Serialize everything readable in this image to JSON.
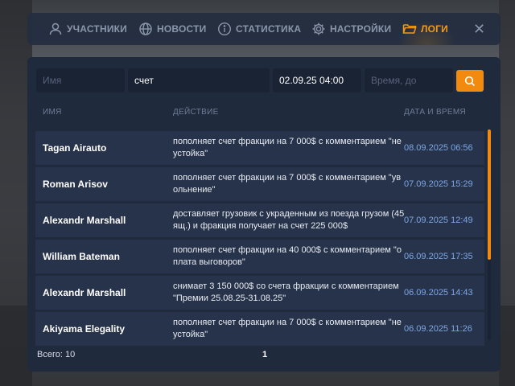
{
  "nav": {
    "tabs": [
      {
        "label": "УЧАСТНИКИ",
        "icon": "user-icon"
      },
      {
        "label": "НОВОСТИ",
        "icon": "globe-icon"
      },
      {
        "label": "СТАТИСТИКА",
        "icon": "info-icon"
      },
      {
        "label": "НАСТРОЙКИ",
        "icon": "gear-icon"
      },
      {
        "label": "ЛОГИ",
        "icon": "folder-icon",
        "active": true
      }
    ],
    "close": "✕"
  },
  "filters": {
    "name_placeholder": "Имя",
    "action_value": "счет",
    "date_from_value": "02.09.25 04:00",
    "date_to_placeholder": "Время, до"
  },
  "table": {
    "headers": {
      "name": "ИМЯ",
      "action": "ДЕЙСТВИЕ",
      "datetime": "ДАТА И ВРЕМЯ"
    },
    "rows": [
      {
        "name": "Tagan Airauto",
        "action": "пополняет счет фракции на 7 000$ с комментарием \"неустойка\"",
        "date": "08.09.2025 06:56"
      },
      {
        "name": "Roman Arisov",
        "action": "пополняет счет фракции на 7 000$ с комментарием \"увольнение\"",
        "date": "07.09.2025 15:29"
      },
      {
        "name": "Alexandr Marshall",
        "action": "доставляет грузовик с украденным из поезда грузом (45 ящ.) и фракция получает на счет 225 000$",
        "date": "07.09.2025 12:49"
      },
      {
        "name": "William Bateman",
        "action": "пополняет счет фракции на 40 000$ с комментарием \"оплата выговоров\"",
        "date": "06.09.2025 17:35"
      },
      {
        "name": "Alexandr Marshall",
        "action": "снимает 3 150 000$ со счета фракции с комментарием \"Премии 25.08.25-31.08.25\"",
        "date": "06.09.2025 14:43"
      },
      {
        "name": "Akiyama Elegality",
        "action": "пополняет счет фракции на 7 000$ с комментарием \"неустойка\"",
        "date": "06.09.2025 11:26"
      }
    ]
  },
  "footer": {
    "total": "Всего: 10",
    "page": "1"
  },
  "colors": {
    "accent": "#f28a10",
    "date_text": "#7da7e6",
    "panel_bg": "#1f2a3c",
    "row_bg": "#27334a"
  }
}
